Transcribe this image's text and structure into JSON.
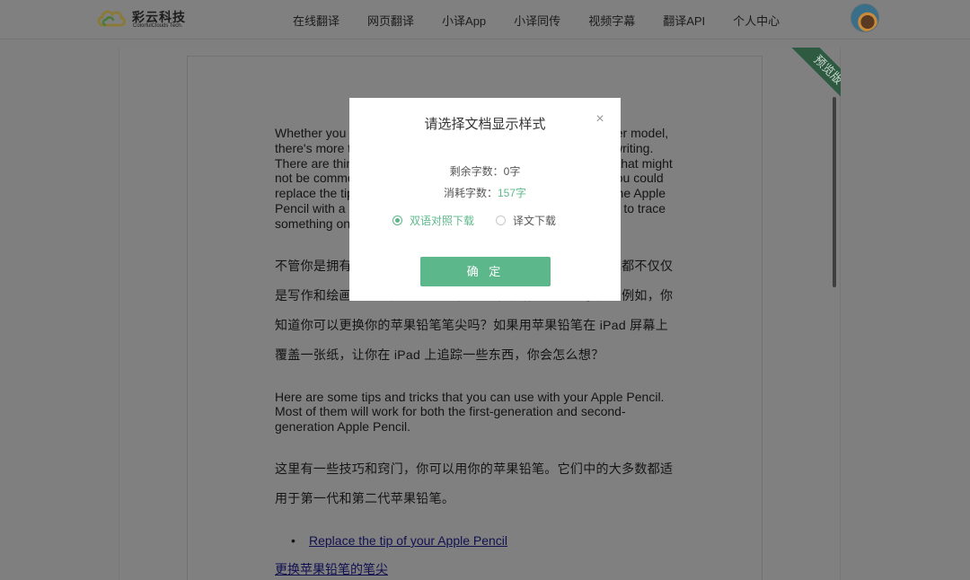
{
  "header": {
    "logo_name": "彩云科技",
    "logo_sub": "ColorfulClouds Tech.",
    "nav": [
      "在线翻译",
      "网页翻译",
      "小译App",
      "小译同传",
      "视频字幕",
      "翻译API",
      "个人中心"
    ]
  },
  "ribbon": "预览版",
  "document": {
    "paragraphs": [
      {
        "lang": "en",
        "text": "Whether you own the first-generation Apple Pencil or the newer model, there's more than one way to use it beyond just drawing and writing. There are things you might not know about your Apple Pencil that might not be common knowledge. For instance, did you know that you could replace the tip of your Apple Pencil? What if you could cover the Apple Pencil with a piece of paper on your iPad screen, allowing you to trace something on the iPad?"
      },
      {
        "lang": "zh",
        "text": "不管你是拥有第一代苹果铅笔还是更新的型号，使用它的方式都不仅仅是写作和绘画。你可能不知道关于你的苹果铅笔的一些事情。例如，你知道你可以更换你的苹果铅笔笔尖吗？如果用苹果铅笔在 iPad 屏幕上覆盖一张纸，让你在 iPad 上追踪一些东西，你会怎么想？"
      },
      {
        "lang": "en",
        "text": "Here are some tips and tricks that you can use with your Apple Pencil. Most of them will work for both the first-generation and second-generation Apple Pencil."
      },
      {
        "lang": "zh",
        "text": "这里有一些技巧和窍门，你可以用你的苹果铅笔。它们中的大多数都适用于第一代和第二代苹果铅笔。"
      }
    ],
    "bullet_link": "Replace the tip of your Apple Pencil",
    "zh_link": "更换苹果铅笔的笔尖"
  },
  "modal": {
    "title": "请选择文档显示样式",
    "remaining_label": "剩余字数：",
    "remaining_value": "0字",
    "consumed_label": "消耗字数：",
    "consumed_value": "157字",
    "option_bilingual": "双语对照下载",
    "option_translation": "译文下载",
    "confirm": "确 定",
    "close_symbol": "×"
  },
  "colors": {
    "accent": "#5cb88a",
    "ribbon": "#2e5a42",
    "overlay": "#808080"
  }
}
